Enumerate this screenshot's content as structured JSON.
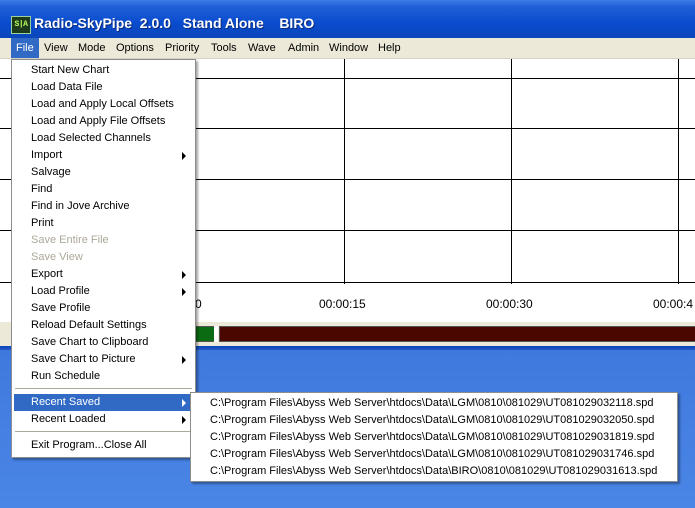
{
  "window": {
    "icon_text": "S|A",
    "title": "Radio-SkyPipe  2.0.0   Stand Alone    BIRO"
  },
  "menubar": [
    {
      "label": "File",
      "active": true
    },
    {
      "label": "View"
    },
    {
      "label": "Mode"
    },
    {
      "label": "Options"
    },
    {
      "label": "Priority"
    },
    {
      "label": "Tools"
    },
    {
      "label": "Wave"
    },
    {
      "label": "Admin"
    },
    {
      "label": "Window"
    },
    {
      "label": "Help"
    }
  ],
  "chart": {
    "tick_labels": [
      "0",
      "00:00:15",
      "00:00:30",
      "00:00:4"
    ]
  },
  "file_menu": {
    "items": [
      {
        "label": "Start New Chart"
      },
      {
        "label": "Load Data File"
      },
      {
        "label": "Load and Apply Local Offsets"
      },
      {
        "label": "Load and Apply File Offsets"
      },
      {
        "label": "Load Selected Channels"
      },
      {
        "label": "Import",
        "submenu": true
      },
      {
        "label": "Salvage"
      },
      {
        "label": "Find"
      },
      {
        "label": "Find in Jove Archive"
      },
      {
        "label": "Print"
      },
      {
        "label": "Save Entire File",
        "disabled": true
      },
      {
        "label": "Save View",
        "disabled": true
      },
      {
        "label": "Export",
        "submenu": true
      },
      {
        "label": "Load Profile",
        "submenu": true
      },
      {
        "label": "Save Profile"
      },
      {
        "label": "Reload Default Settings"
      },
      {
        "label": "Save Chart to Clipboard"
      },
      {
        "label": "Save Chart to Picture",
        "submenu": true
      },
      {
        "label": "Run Schedule"
      },
      {
        "label": "Recent Saved",
        "submenu": true,
        "selected": true
      },
      {
        "label": "Recent Loaded",
        "submenu": true
      },
      {
        "label": "Exit Program...Close All"
      }
    ]
  },
  "recent_saved": {
    "items": [
      "C:\\Program Files\\Abyss Web Server\\htdocs\\Data\\LGM\\0810\\081029\\UT081029032118.spd",
      "C:\\Program Files\\Abyss Web Server\\htdocs\\Data\\LGM\\0810\\081029\\UT081029032050.spd",
      "C:\\Program Files\\Abyss Web Server\\htdocs\\Data\\LGM\\0810\\081029\\UT081029031819.spd",
      "C:\\Program Files\\Abyss Web Server\\htdocs\\Data\\LGM\\0810\\081029\\UT081029031746.spd",
      "C:\\Program Files\\Abyss Web Server\\htdocs\\Data\\BIRO\\0810\\081029\\UT081029031613.spd"
    ]
  }
}
